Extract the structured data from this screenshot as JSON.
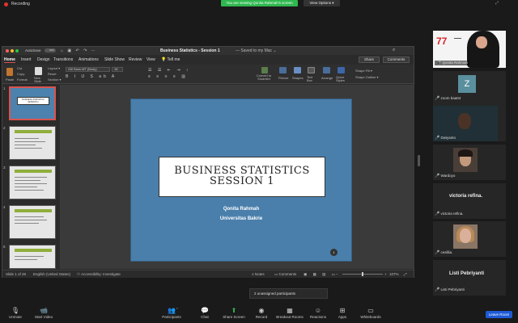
{
  "topbar": {
    "recording_label": "Recording",
    "viewing_banner": "You are viewing Qonita Rahmah's screen",
    "view_options": "View Options ▾"
  },
  "ppt": {
    "autosave_label": "AutoSave",
    "autosave_state": "OFF",
    "doc_title": "Business Statistics - Session 1",
    "doc_saved": "— Saved to my Mac ⌄",
    "tabs": [
      "Home",
      "Insert",
      "Design",
      "Transitions",
      "Animations",
      "Slide Show",
      "Review",
      "View",
      "Tell me"
    ],
    "share_label": "Share",
    "comments_label": "Comments",
    "ribbon": {
      "paste": "Paste",
      "cut": "Cut",
      "copy": "Copy",
      "format": "Format",
      "new_slide": "New Slide",
      "layout": "Layout ▾",
      "reset": "Reset",
      "section": "Section ▾",
      "font_name": "Gill Sans MT (Body)",
      "font_size": "18",
      "convert_smartart": "Convert to SmartArt",
      "picture": "Picture",
      "shapes": "Shapes",
      "text_box": "Text Box",
      "arrange": "Arrange",
      "quick_styles": "Quick Styles",
      "shape_fill": "Shape Fill ▾",
      "shape_outline": "Shape Outline ▾"
    },
    "slide": {
      "title_line1": "Business Statistics",
      "title_line2": "Session 1",
      "author": "Qonita Rahmah",
      "institution": "Universitas Bakrie",
      "page_number": "1"
    },
    "thumbnails": [
      "1",
      "2",
      "3",
      "4",
      "5"
    ],
    "thumb1_text": "BUSINESS STATISTICS SESSION 1",
    "status": {
      "slide_of": "Slide 1 of 28",
      "language": "English (United States)",
      "accessibility": "Accessibility: Investigate",
      "notes": "Notes",
      "comments": "Comments",
      "zoom": "107%"
    }
  },
  "participants": [
    {
      "name": "Qonita Rahmah"
    },
    {
      "name": "zoom baa04"
    },
    {
      "name": "Dwiyanto"
    },
    {
      "name": "Wardoyo"
    },
    {
      "name": "victoria refina.",
      "display": "victoria refina."
    },
    {
      "name": "cesillia."
    },
    {
      "name": "Listi Pebriyanti",
      "display": "Listi Pebriyanti"
    }
  ],
  "zoom_tile_letter": "Z",
  "unassigned": "2 unassigned participants",
  "toolbar": {
    "unmute": "Unmute",
    "start_video": "Start Video",
    "participants": "Participants",
    "participants_count": "7",
    "chat": "Chat",
    "share_screen": "Share Screen",
    "record": "Record",
    "breakout_rooms": "Breakout Rooms",
    "reactions": "Reactions",
    "apps": "Apps",
    "whiteboards": "Whiteboards",
    "leave": "Leave Room"
  },
  "colors": {
    "slide_bg": "#4a7fab",
    "share_green": "#2fb84f",
    "leave_blue": "#1e5ad6",
    "mic_off_red": "#e0342f"
  }
}
